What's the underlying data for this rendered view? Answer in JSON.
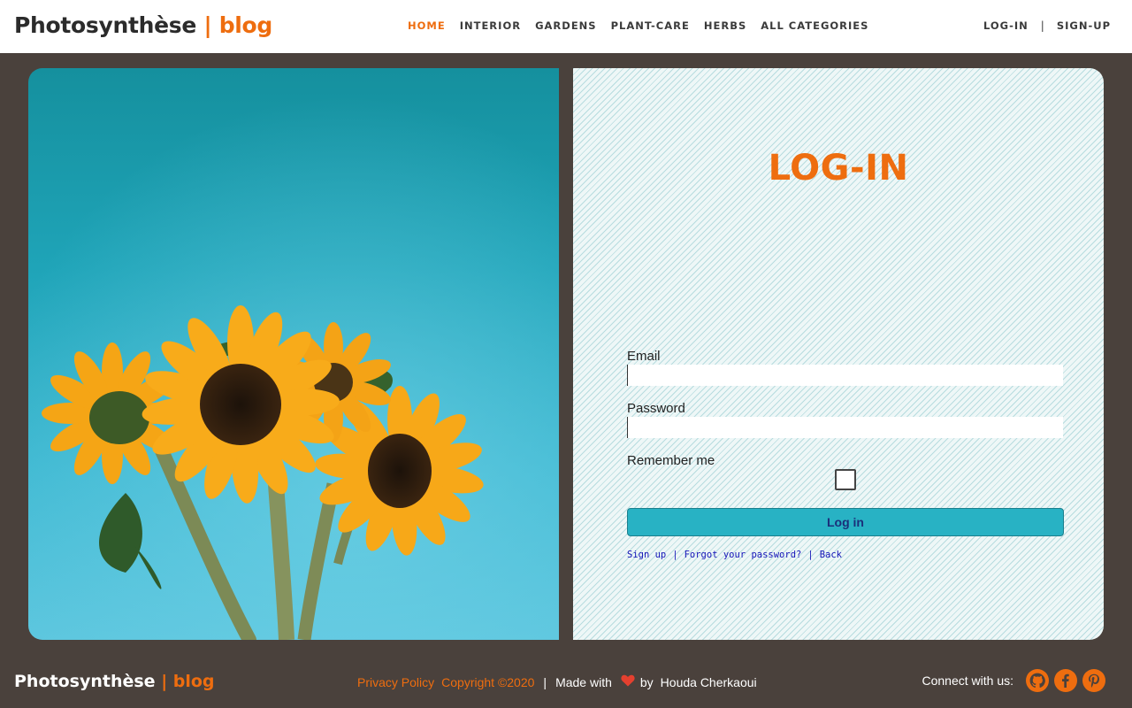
{
  "header": {
    "brand_main": "Photosynthèse",
    "brand_accent": "| blog",
    "nav": [
      {
        "label": "HOME",
        "active": true
      },
      {
        "label": "INTERIOR"
      },
      {
        "label": "GARDENS"
      },
      {
        "label": "PLANT-CARE"
      },
      {
        "label": "HERBS"
      },
      {
        "label": "ALL CATEGORIES"
      }
    ],
    "login_label": "LOG-IN",
    "separator": "|",
    "signup_label": "SIGN-UP"
  },
  "login": {
    "title": "LOG-IN",
    "email_label": "Email",
    "email_value": "",
    "password_label": "Password",
    "password_value": "",
    "remember_label": "Remember me",
    "remember_checked": false,
    "submit_label": "Log in",
    "links": {
      "signup": "Sign up",
      "forgot": "Forgot your password?",
      "back": "Back",
      "pipe": "|"
    }
  },
  "footer": {
    "brand_main": "Photosynthèse",
    "brand_accent": "| blog",
    "privacy": "Privacy Policy",
    "copyright": "Copyright ©2020",
    "pipe": "|",
    "made_with": "Made with",
    "by": "by",
    "author": "Houda Cherkaoui",
    "connect": "Connect with us:",
    "social_icons": [
      "github-icon",
      "facebook-icon",
      "pinterest-icon"
    ]
  },
  "colors": {
    "accent": "#ee6d0f",
    "background": "#4a413c",
    "button": "#28b2c4",
    "link": "#1515b8"
  }
}
